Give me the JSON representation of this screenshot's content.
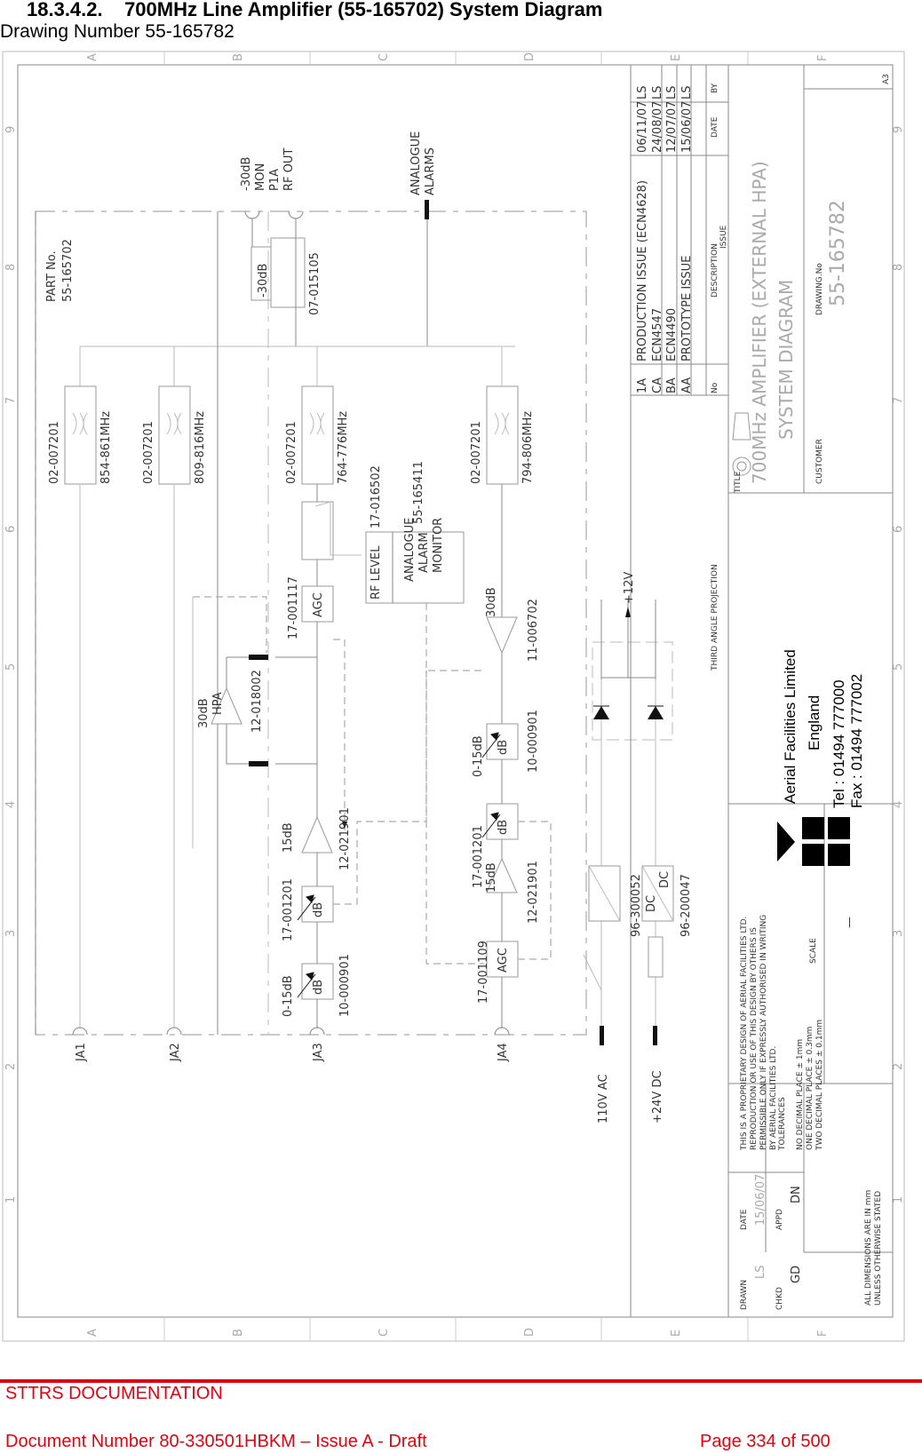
{
  "header": {
    "section_title": "18.3.4.2.    700MHz Line Amplifier (55-165702) System Diagram",
    "drawing_number_line": "Drawing Number 55-165782"
  },
  "footer": {
    "org": "STTRS DOCUMENTATION",
    "document_number": "Document Number 80-330501HBKM – Issue A - Draft",
    "page": "Page 334 of 500",
    "accent_color": "#e8000f"
  },
  "frame": {
    "column_letters": [
      "A",
      "B",
      "C",
      "D",
      "E",
      "F"
    ],
    "row_numbers": [
      "9",
      "8",
      "7",
      "6",
      "5",
      "4",
      "3",
      "2",
      "1"
    ]
  },
  "schematic": {
    "part_no_label": "PART No.",
    "part_no": "55-165702",
    "rf_out_connector": [
      "-30dB",
      "MON",
      "P1A",
      "RF OUT"
    ],
    "analogue_alarms": [
      "ANALOGUE",
      "ALARMS"
    ],
    "coupler": {
      "value": "-30dB",
      "part": "07-015105"
    },
    "filters": [
      {
        "part": "02-007201",
        "band": "854-861MHz"
      },
      {
        "part": "02-007201",
        "band": "809-816MHz"
      },
      {
        "part": "02-007201",
        "band": "764-776MHz"
      },
      {
        "part": "02-007201",
        "band": "794-806MHz"
      }
    ],
    "rf_level": {
      "label": "RF LEVEL",
      "part": "17-016502"
    },
    "alarm_monitor": {
      "lines": [
        "ANALOGUE",
        "ALARM",
        "MONITOR"
      ],
      "part": "55-165411"
    },
    "agc_top": {
      "label": "AGC",
      "part": "17-001117"
    },
    "hpa": {
      "gain": "30dB",
      "label": "HPA",
      "part": "12-018002"
    },
    "amp_30db": {
      "gain": "30dB",
      "part": "11-006702"
    },
    "chain_a": {
      "att1": {
        "label": "dB",
        "range": "0-15dB",
        "part": "10-000901"
      },
      "att2": {
        "label": "dB",
        "part": "17-001201"
      },
      "amp": {
        "gain": "15dB",
        "part": "12-021901"
      }
    },
    "chain_b": {
      "agc": {
        "label": "AGC",
        "part": "17-001109"
      },
      "amp": {
        "gain": "15dB",
        "part": "12-021901"
      },
      "att2": {
        "label": "dB",
        "part": "17-001201"
      },
      "att1": {
        "label": "dB",
        "range": "0-15dB",
        "part": "10-000901"
      }
    },
    "ports": [
      "JA1",
      "JA2",
      "JA3",
      "JA4"
    ],
    "power": {
      "ac_in": "110V AC",
      "dc_in": "+24V DC",
      "psu_ac": "96-300052",
      "psu_dc": "96-200047",
      "dc_label": "DC",
      "rail": "+12V"
    }
  },
  "title_block": {
    "revisions": [
      {
        "no": "1A",
        "description": "PRODUCTION ISSUE (ECN4628)",
        "date": "06/11/07",
        "by": "LS"
      },
      {
        "no": "CA",
        "description": "ECN4547",
        "date": "24/08/07",
        "by": "LS"
      },
      {
        "no": "BA",
        "description": "ECN4490",
        "date": "12/07/07",
        "by": "LS"
      },
      {
        "no": "AA",
        "description": "PROTOTYPE ISSUE",
        "date": "15/06/07",
        "by": "LS"
      }
    ],
    "rev_headers": {
      "no": "No",
      "description": "DESCRIPTION",
      "date": "DATE",
      "by": "BY",
      "issue": "ISSUE"
    },
    "sheet_size": "A3",
    "projection": "THIRD ANGLE PROJECTION",
    "title_label": "TITLE",
    "title_line1": "700MHz AMPLIFIER (EXTERNAL HPA)",
    "title_line2": "SYSTEM DIAGRAM",
    "customer_label": "CUSTOMER",
    "drawing_no_label": "DRAWING.No",
    "drawing_no": "55-165782",
    "company": {
      "name": "Aerial Facilities Limited",
      "country": "England",
      "tel": "Tel : 01494 777000",
      "fax": "Fax : 01494 777002"
    },
    "proprietary": [
      "THIS IS A PROPRIETARY DESIGN OF AERIAL FACILITIES LTD.",
      "REPRODUCTION OR USE OF THIS DESIGN BY OTHERS IS",
      "PERMISSIBLE ONLY IF EXPRESSLY AUTHORISED IN WRITING",
      "BY AERIAL FACILITIES LTD."
    ],
    "scale_label": "SCALE",
    "scale_value": "—",
    "tolerances_label": "TOLERANCES",
    "tolerances": [
      "NO DECIMAL PLACE ± 1mm",
      "ONE DECIMAL PLACE ± 0.3mm",
      "TWO DECIMAL PLACES ± 0.1mm"
    ],
    "drawn_label": "DRAWN",
    "drawn": "LS",
    "date_label": "DATE",
    "date": "15/06/07",
    "chkd_label": "CHKD",
    "chkd": "GD",
    "appd_label": "APPD",
    "appd": "DN",
    "dimensions_note": [
      "ALL DIMENSIONS ARE IN mm",
      "UNLESS OTHERWISE STATED"
    ]
  }
}
